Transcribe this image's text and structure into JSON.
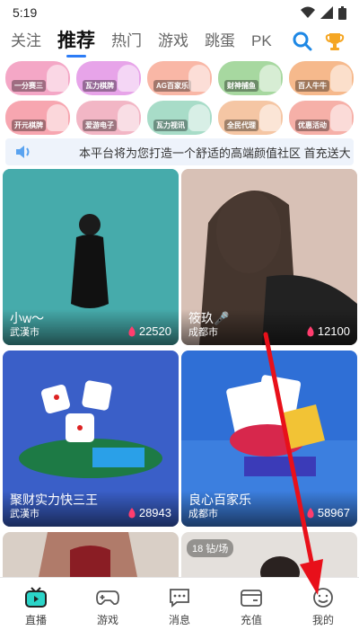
{
  "status_bar": {
    "time": "5:19",
    "icons": [
      "wifi-icon",
      "signal-icon",
      "battery-icon"
    ]
  },
  "top_tabs": {
    "items": [
      {
        "label": "关注"
      },
      {
        "label": "推荐",
        "active": true
      },
      {
        "label": "热门"
      },
      {
        "label": "游戏"
      },
      {
        "label": "跳蛋"
      },
      {
        "label": "PK"
      }
    ],
    "right_icons": [
      "search-icon",
      "trophy-icon"
    ]
  },
  "banners": [
    {
      "label": "一分赛三",
      "color": "#f4a7c6"
    },
    {
      "label": "瓦力棋牌",
      "color": "#e7a4e9"
    },
    {
      "label": "AG百家乐",
      "color": "#f9b7a6"
    },
    {
      "label": "财神捕鱼",
      "color": "#a7d8a0"
    },
    {
      "label": "百人牛牛",
      "color": "#f6b98c"
    },
    {
      "label": "开元棋牌",
      "color": "#f7a6b0"
    },
    {
      "label": "爱游电子",
      "color": "#f2b6c5"
    },
    {
      "label": "瓦力视讯",
      "color": "#a8dcc8"
    },
    {
      "label": "全民代理",
      "color": "#f5c6a4"
    },
    {
      "label": "优惠活动",
      "color": "#f6b0a8"
    }
  ],
  "notice": {
    "text": "本平台将为您打造一个舒适的高端颜值社区   首充送大"
  },
  "cards": [
    {
      "title": "小w〜",
      "city": "武漢市",
      "count": "22520",
      "bg": "#3a9ea0"
    },
    {
      "title": "筱玖🎤",
      "city": "成都市",
      "count": "12100",
      "bg": "#c9a99a"
    },
    {
      "title": "聚财实力快三王",
      "city": "武漢市",
      "count": "28943",
      "bg": "#3a5fc8"
    },
    {
      "title": "良心百家乐",
      "city": "成都市",
      "count": "58967",
      "bg": "#2f6fd6"
    },
    {
      "title": "",
      "city": "",
      "count": "",
      "bg": "#c89a86"
    },
    {
      "title": "",
      "city": "",
      "count": "",
      "bg": "#d9d4ce",
      "badge": "18 钻/场"
    }
  ],
  "bottom_nav": {
    "items": [
      {
        "label": "直播",
        "icon": "tv-icon",
        "active": true
      },
      {
        "label": "游戏",
        "icon": "gamepad-icon"
      },
      {
        "label": "消息",
        "icon": "message-icon"
      },
      {
        "label": "充值",
        "icon": "wallet-icon"
      },
      {
        "label": "我的",
        "icon": "profile-icon"
      }
    ]
  },
  "colors": {
    "accent": "#2c7cf6",
    "arrow": "#e8101a",
    "count_icon": "#ff3d6e"
  }
}
